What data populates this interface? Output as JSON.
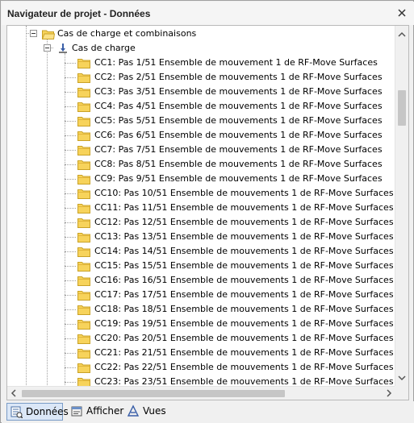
{
  "window": {
    "title": "Navigateur de projet - Données",
    "close_icon": "close-icon"
  },
  "tree": {
    "group_label": "Cas de charge et combinaisons",
    "subgroup_label": "Cas de charge",
    "items": [
      "CC1: Pas 1/51 Ensemble de mouvement 1 de RF-Move Surfaces",
      "CC2: Pas 2/51 Ensemble de mouvements 1 de RF-Move Surfaces",
      "CC3: Pas 3/51 Ensemble de mouvements 1 de RF-Move Surfaces",
      "CC4: Pas 4/51 Ensemble de mouvements 1 de RF-Move Surfaces",
      "CC5: Pas 5/51 Ensemble de mouvements 1 de RF-Move Surfaces",
      "CC6: Pas 6/51 Ensemble de mouvements 1 de RF-Move Surfaces",
      "CC7: Pas 7/51 Ensemble de mouvements 1 de RF-Move Surfaces",
      "CC8: Pas 8/51 Ensemble de mouvements 1 de RF-Move Surfaces",
      "CC9: Pas 9/51 Ensemble de mouvements 1 de RF-Move Surfaces",
      "CC10: Pas 10/51 Ensemble de mouvements 1 de RF-Move Surfaces",
      "CC11: Pas 11/51 Ensemble de mouvements 1 de RF-Move Surfaces",
      "CC12: Pas 12/51 Ensemble de mouvements 1 de RF-Move Surfaces",
      "CC13: Pas 13/51 Ensemble de mouvements 1 de RF-Move Surfaces",
      "CC14: Pas 14/51 Ensemble de mouvements 1 de RF-Move Surfaces",
      "CC15: Pas 15/51 Ensemble de mouvements 1 de RF-Move Surfaces",
      "CC16: Pas 16/51 Ensemble de mouvements 1 de RF-Move Surfaces",
      "CC17: Pas 17/51 Ensemble de mouvements 1 de RF-Move Surfaces",
      "CC18: Pas 18/51 Ensemble de mouvements 1 de RF-Move Surfaces",
      "CC19: Pas 19/51 Ensemble de mouvements 1 de RF-Move Surfaces",
      "CC20: Pas 20/51 Ensemble de mouvements 1 de RF-Move Surfaces",
      "CC21: Pas 21/51 Ensemble de mouvements 1 de RF-Move Surfaces",
      "CC22: Pas 22/51 Ensemble de mouvements 1 de RF-Move Surfaces",
      "CC23: Pas 23/51 Ensemble de mouvements 1 de RF-Move Surfaces"
    ],
    "folder_icon": "folder-icon",
    "loadcase_icon": "load-case-icon"
  },
  "tabs": [
    {
      "label": "Données",
      "icon": "data-tab-icon",
      "active": true
    },
    {
      "label": "Afficher",
      "icon": "display-tab-icon",
      "active": false
    },
    {
      "label": "Vues",
      "icon": "views-tab-icon",
      "active": false
    }
  ],
  "colors": {
    "folder": "#f7d35b",
    "folder_outline": "#c9a227",
    "active_tab_bg": "#dbe7f7",
    "active_tab_border": "#7a9cc7"
  }
}
